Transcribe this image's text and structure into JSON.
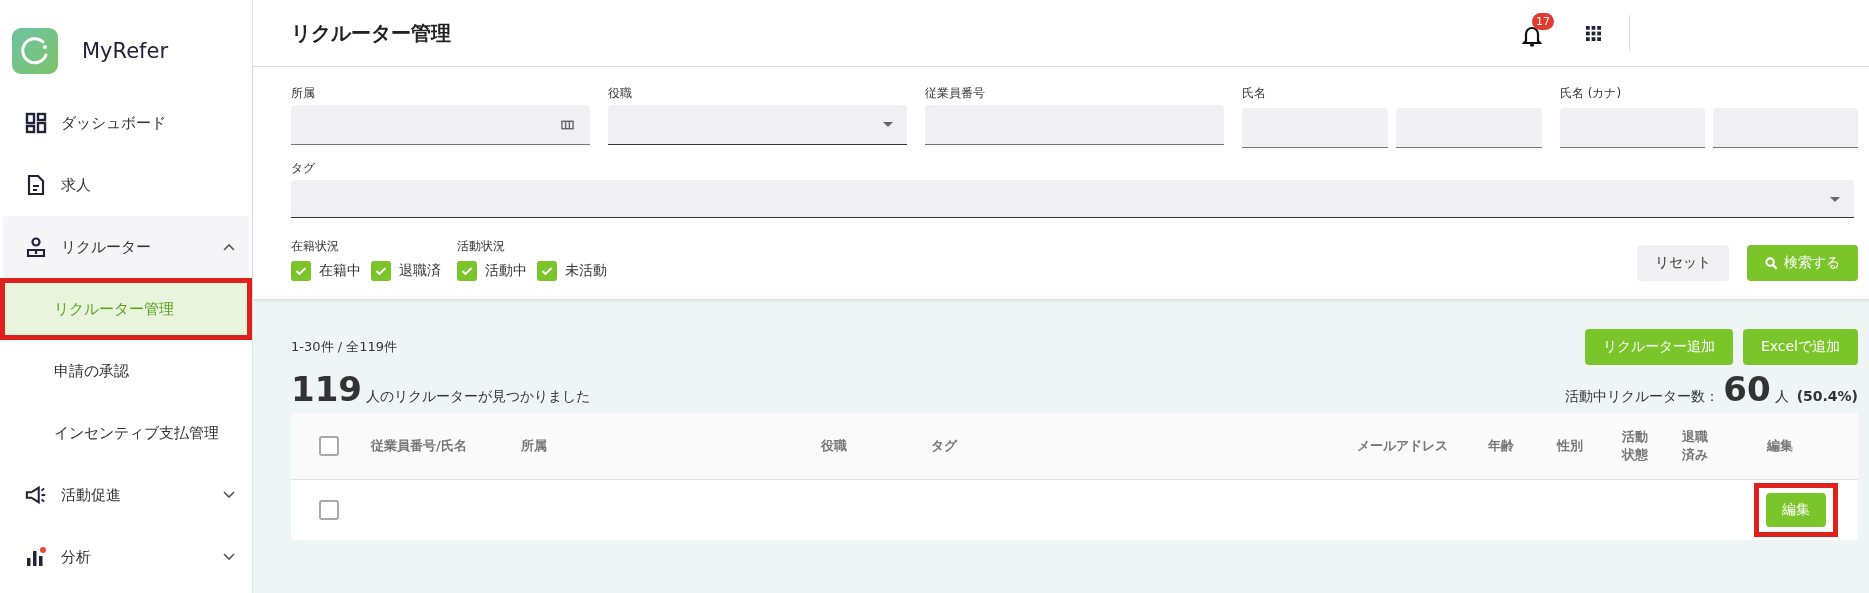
{
  "app": {
    "name": "MyRefer"
  },
  "sidebar": {
    "items": [
      {
        "label": "ダッシュボード",
        "kind": "link"
      },
      {
        "label": "求人",
        "kind": "link"
      },
      {
        "label": "リクルーター",
        "kind": "group",
        "expanded": true,
        "children": [
          {
            "label": "リクルーター管理",
            "selected": true,
            "highlighted": true
          },
          {
            "label": "申請の承認",
            "selected": false,
            "highlighted": false
          },
          {
            "label": "インセンティブ支払管理",
            "selected": false,
            "highlighted": false
          }
        ]
      },
      {
        "label": "活動促進",
        "kind": "group",
        "expanded": false
      },
      {
        "label": "分析",
        "kind": "group",
        "expanded": false
      }
    ]
  },
  "header": {
    "title": "リクルーター管理",
    "notification_count": "17"
  },
  "filters": {
    "fields": [
      {
        "label": "所属",
        "kind": "picker"
      },
      {
        "label": "役職",
        "kind": "select"
      },
      {
        "label": "従業員番号",
        "kind": "text"
      },
      {
        "label": "氏名",
        "kind": "pair"
      },
      {
        "label": "氏名 (カナ)",
        "kind": "pair"
      }
    ],
    "tag": {
      "label": "タグ",
      "kind": "select"
    },
    "checkbox_groups": [
      {
        "label": "在籍状況",
        "options": [
          {
            "label": "在籍中",
            "checked": true
          },
          {
            "label": "退職済",
            "checked": true
          }
        ]
      },
      {
        "label": "活動状況",
        "options": [
          {
            "label": "活動中",
            "checked": true
          },
          {
            "label": "未活動",
            "checked": true
          }
        ]
      }
    ],
    "buttons": [
      {
        "label": "リセット",
        "kind": "secondary"
      },
      {
        "label": "検索する",
        "kind": "search"
      }
    ]
  },
  "results": {
    "range": "1-30件 / 全119件",
    "count": "119",
    "count_text": "人のリクルーターが見つかりました",
    "actions": [
      "リクルーター追加",
      "Excelで追加"
    ],
    "active_label": "活動中リクルーター数：",
    "active_count": "60",
    "active_unit": "人",
    "active_percent": "(50.4%)"
  },
  "table": {
    "columns": [
      "従業員番号/氏名",
      "所属",
      "役職",
      "タグ",
      "メールアドレス",
      "年齢",
      "性別",
      "活動状態",
      "退職済み",
      "編集"
    ],
    "header_checked": false,
    "rows": [
      {
        "checked": false,
        "edit": "編集",
        "highlighted": true
      }
    ]
  }
}
